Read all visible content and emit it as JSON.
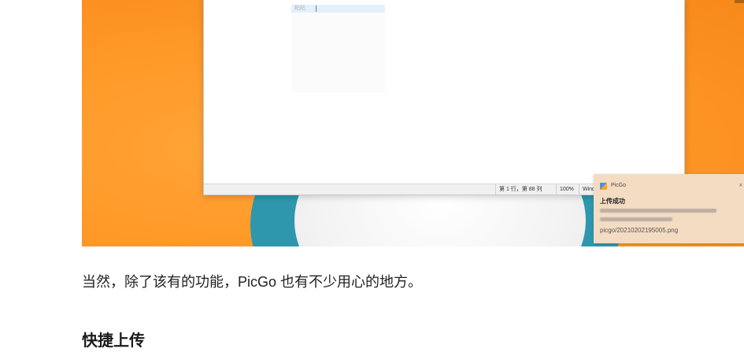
{
  "screenshot": {
    "editor": {
      "selected_text": "粘贴"
    },
    "statusbar": {
      "position": "第 1 行，第 88 列",
      "zoom": "100%",
      "line_ending": "Windo"
    },
    "notification": {
      "app_name": "PicGo",
      "close_glyph": "×",
      "title": "上传成功",
      "file": "picgo/20210202195005.png"
    }
  },
  "article": {
    "paragraph": "当然，除了该有的功能，PicGo 也有不少用心的地方。",
    "heading": "快捷上传"
  }
}
